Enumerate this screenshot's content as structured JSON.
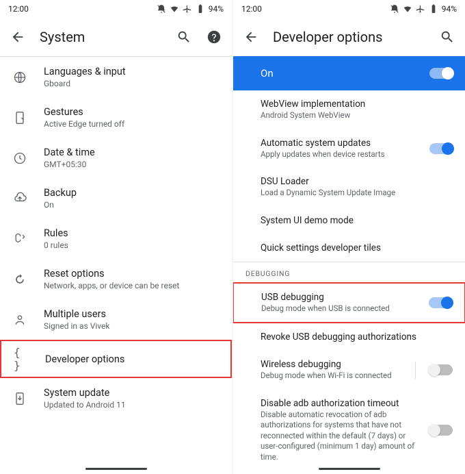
{
  "status": {
    "time": "12:00",
    "battery": "94%"
  },
  "left": {
    "title": "System",
    "items": [
      {
        "title": "Languages & input",
        "sub": "Gboard"
      },
      {
        "title": "Gestures",
        "sub": "Active Edge turned off"
      },
      {
        "title": "Date & time",
        "sub": "GMT+05:30"
      },
      {
        "title": "Backup",
        "sub": "On"
      },
      {
        "title": "Rules",
        "sub": "0 rules"
      },
      {
        "title": "Reset options",
        "sub": "Network, apps, or device can be reset"
      },
      {
        "title": "Multiple users",
        "sub": "Signed in as Vivek"
      },
      {
        "title": "Developer options",
        "sub": ""
      },
      {
        "title": "System update",
        "sub": "Updated to Android 11"
      }
    ]
  },
  "right": {
    "title": "Developer options",
    "master": {
      "label": "On",
      "checked": true
    },
    "items_top": [
      {
        "title": "WebView implementation",
        "sub": "Android System WebView"
      },
      {
        "title": "Automatic system updates",
        "sub": "Apply updates when device restarts",
        "toggle": true,
        "checked": true
      },
      {
        "title": "DSU Loader",
        "sub": "Load a Dynamic System Update Image"
      },
      {
        "title": "System UI demo mode",
        "sub": ""
      },
      {
        "title": "Quick settings developer tiles",
        "sub": ""
      }
    ],
    "section": "DEBUGGING",
    "items_debug": [
      {
        "title": "USB debugging",
        "sub": "Debug mode when USB is connected",
        "toggle": true,
        "checked": true,
        "highlight": true
      },
      {
        "title": "Revoke USB debugging authorizations",
        "sub": ""
      },
      {
        "title": "Wireless debugging",
        "sub": "Debug mode when Wi-Fi is connected",
        "toggle": true,
        "checked": false,
        "vsep": true
      },
      {
        "title": "Disable adb authorization timeout",
        "sub": "Disable automatic revocation of adb authorizations for systems that have not reconnected within the default (7 days) or user-configured (minimum 1 day) amount of time.",
        "toggle": true,
        "checked": false
      }
    ]
  }
}
